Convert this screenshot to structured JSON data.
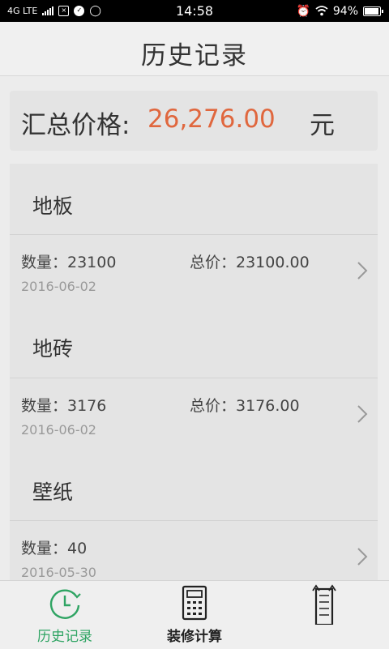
{
  "status_bar": {
    "network": "4G LTE",
    "time": "14:58",
    "battery": "94%"
  },
  "header": {
    "title": "历史记录"
  },
  "summary": {
    "label": "汇总价格:",
    "value": "26,276.00",
    "unit": "元"
  },
  "records": [
    {
      "category": "地板",
      "quantity": "数量：23100",
      "total": "总价：23100.00",
      "date": "2016-06-02"
    },
    {
      "category": "地砖",
      "quantity": "数量：3176",
      "total": "总价：3176.00",
      "date": "2016-06-02"
    },
    {
      "category": "壁纸",
      "quantity": "数量：40",
      "total": "",
      "date": "2016-05-30"
    }
  ],
  "tabs": [
    {
      "label": "历史记录",
      "icon": "clock-icon",
      "active": true,
      "color": "#2fa463"
    },
    {
      "label": "装修计算",
      "icon": "calculator-icon",
      "active": false,
      "color": "#222222"
    },
    {
      "label": "",
      "icon": "ruler-icon",
      "active": false,
      "color": "#222222"
    }
  ],
  "colors": {
    "accent_green": "#2fa463",
    "price_orange": "#e0673e"
  }
}
